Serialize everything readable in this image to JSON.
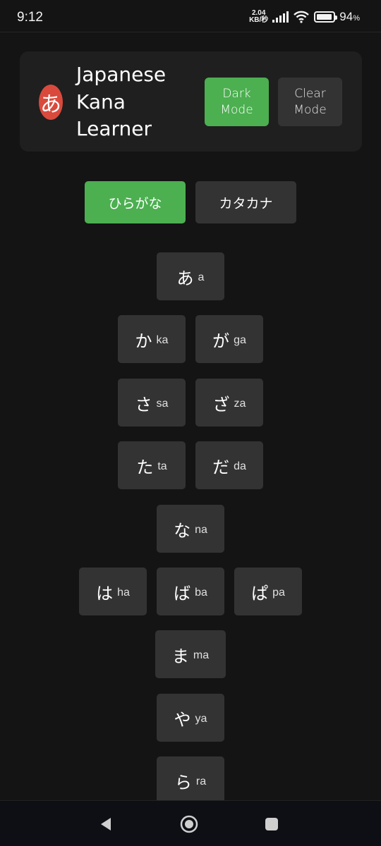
{
  "status_bar": {
    "time": "9:12",
    "net_speed_value": "2.04",
    "net_speed_unit": "KB/秒",
    "battery_percent": "94",
    "battery_unit": "%",
    "battery_level": 0.94
  },
  "header": {
    "logo_char": "あ",
    "title_line1": "Japanese",
    "title_line2": "Kana",
    "title_line3": "Learner",
    "dark_mode_line1": "Dark",
    "dark_mode_line2": "Mode",
    "clear_mode_line1": "Clear",
    "clear_mode_line2": "Mode"
  },
  "tabs": {
    "hiragana": "ひらがな",
    "katakana": "カタカナ",
    "active": "hiragana"
  },
  "kana": [
    {
      "char": "あ",
      "romaji": "a"
    },
    {
      "char": "か",
      "romaji": "ka"
    },
    {
      "char": "が",
      "romaji": "ga"
    },
    {
      "char": "さ",
      "romaji": "sa"
    },
    {
      "char": "ざ",
      "romaji": "za"
    },
    {
      "char": "た",
      "romaji": "ta"
    },
    {
      "char": "だ",
      "romaji": "da"
    },
    {
      "char": "な",
      "romaji": "na"
    },
    {
      "char": "は",
      "romaji": "ha"
    },
    {
      "char": "ば",
      "romaji": "ba"
    },
    {
      "char": "ぱ",
      "romaji": "pa"
    },
    {
      "char": "ま",
      "romaji": "ma"
    },
    {
      "char": "や",
      "romaji": "ya"
    },
    {
      "char": "ら",
      "romaji": "ra"
    }
  ],
  "colors": {
    "background": "#141414",
    "accent": "#4caf50",
    "logo": "#d94a3d",
    "button": "#333333"
  },
  "nav_icons": [
    "back-icon",
    "home-icon",
    "recents-icon"
  ]
}
